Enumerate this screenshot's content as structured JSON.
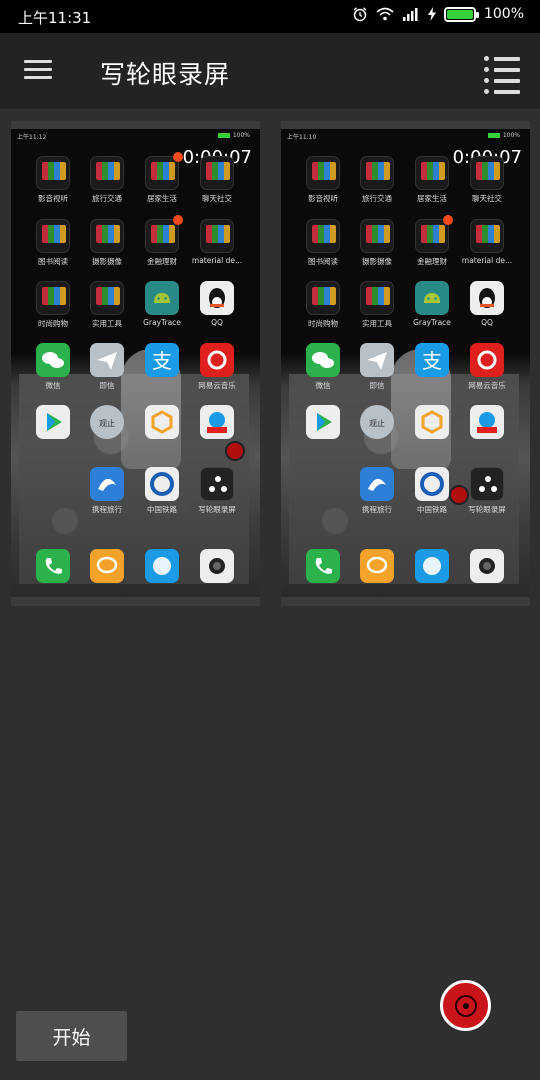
{
  "status_bar": {
    "time": "上午11:31",
    "battery_pct": "100%",
    "battery_level": 1.0,
    "icons": [
      "alarm-icon",
      "wifi-icon",
      "signal-icon",
      "charging-icon",
      "battery-icon"
    ]
  },
  "toolbar": {
    "title": "写轮眼录屏",
    "menu_icon": "hamburger-menu-icon",
    "list_icon": "list-icon"
  },
  "recordings": [
    {
      "status_time": "上午11:12",
      "status_pct": "100%",
      "duration": "0:00:07",
      "rows": [
        [
          "影音视听",
          "旅行交通",
          "居家生活",
          "聊天社交"
        ],
        [
          "图书阅读",
          "摄影摄像",
          "金融理财",
          "material de..."
        ],
        [
          "时尚购物",
          "实用工具",
          "GrayTrace",
          "QQ"
        ],
        [
          "微信",
          "即信",
          "",
          "网易云音乐"
        ],
        [
          "",
          "",
          "",
          ""
        ],
        [
          "",
          "携程旅行",
          "中国铁路",
          "写轮眼录屏"
        ]
      ]
    },
    {
      "status_time": "上午11:10",
      "status_pct": "100%",
      "duration": "0:00:07",
      "rows": [
        [
          "影音视听",
          "旅行交通",
          "居家生活",
          "聊天社交"
        ],
        [
          "图书阅读",
          "摄影摄像",
          "金融理财",
          "material de..."
        ],
        [
          "时尚购物",
          "实用工具",
          "GrayTrace",
          "QQ"
        ],
        [
          "微信",
          "即信",
          "",
          "网易云音乐"
        ],
        [
          "",
          "",
          "",
          ""
        ],
        [
          "",
          "携程旅行",
          "中国铁路",
          "写轮眼录屏"
        ]
      ]
    }
  ],
  "app_icons": {
    "qq": "QQ",
    "doc_label": "观止"
  },
  "start_button": {
    "label": "开始"
  },
  "fab": {
    "icon": "sharingan-icon"
  }
}
